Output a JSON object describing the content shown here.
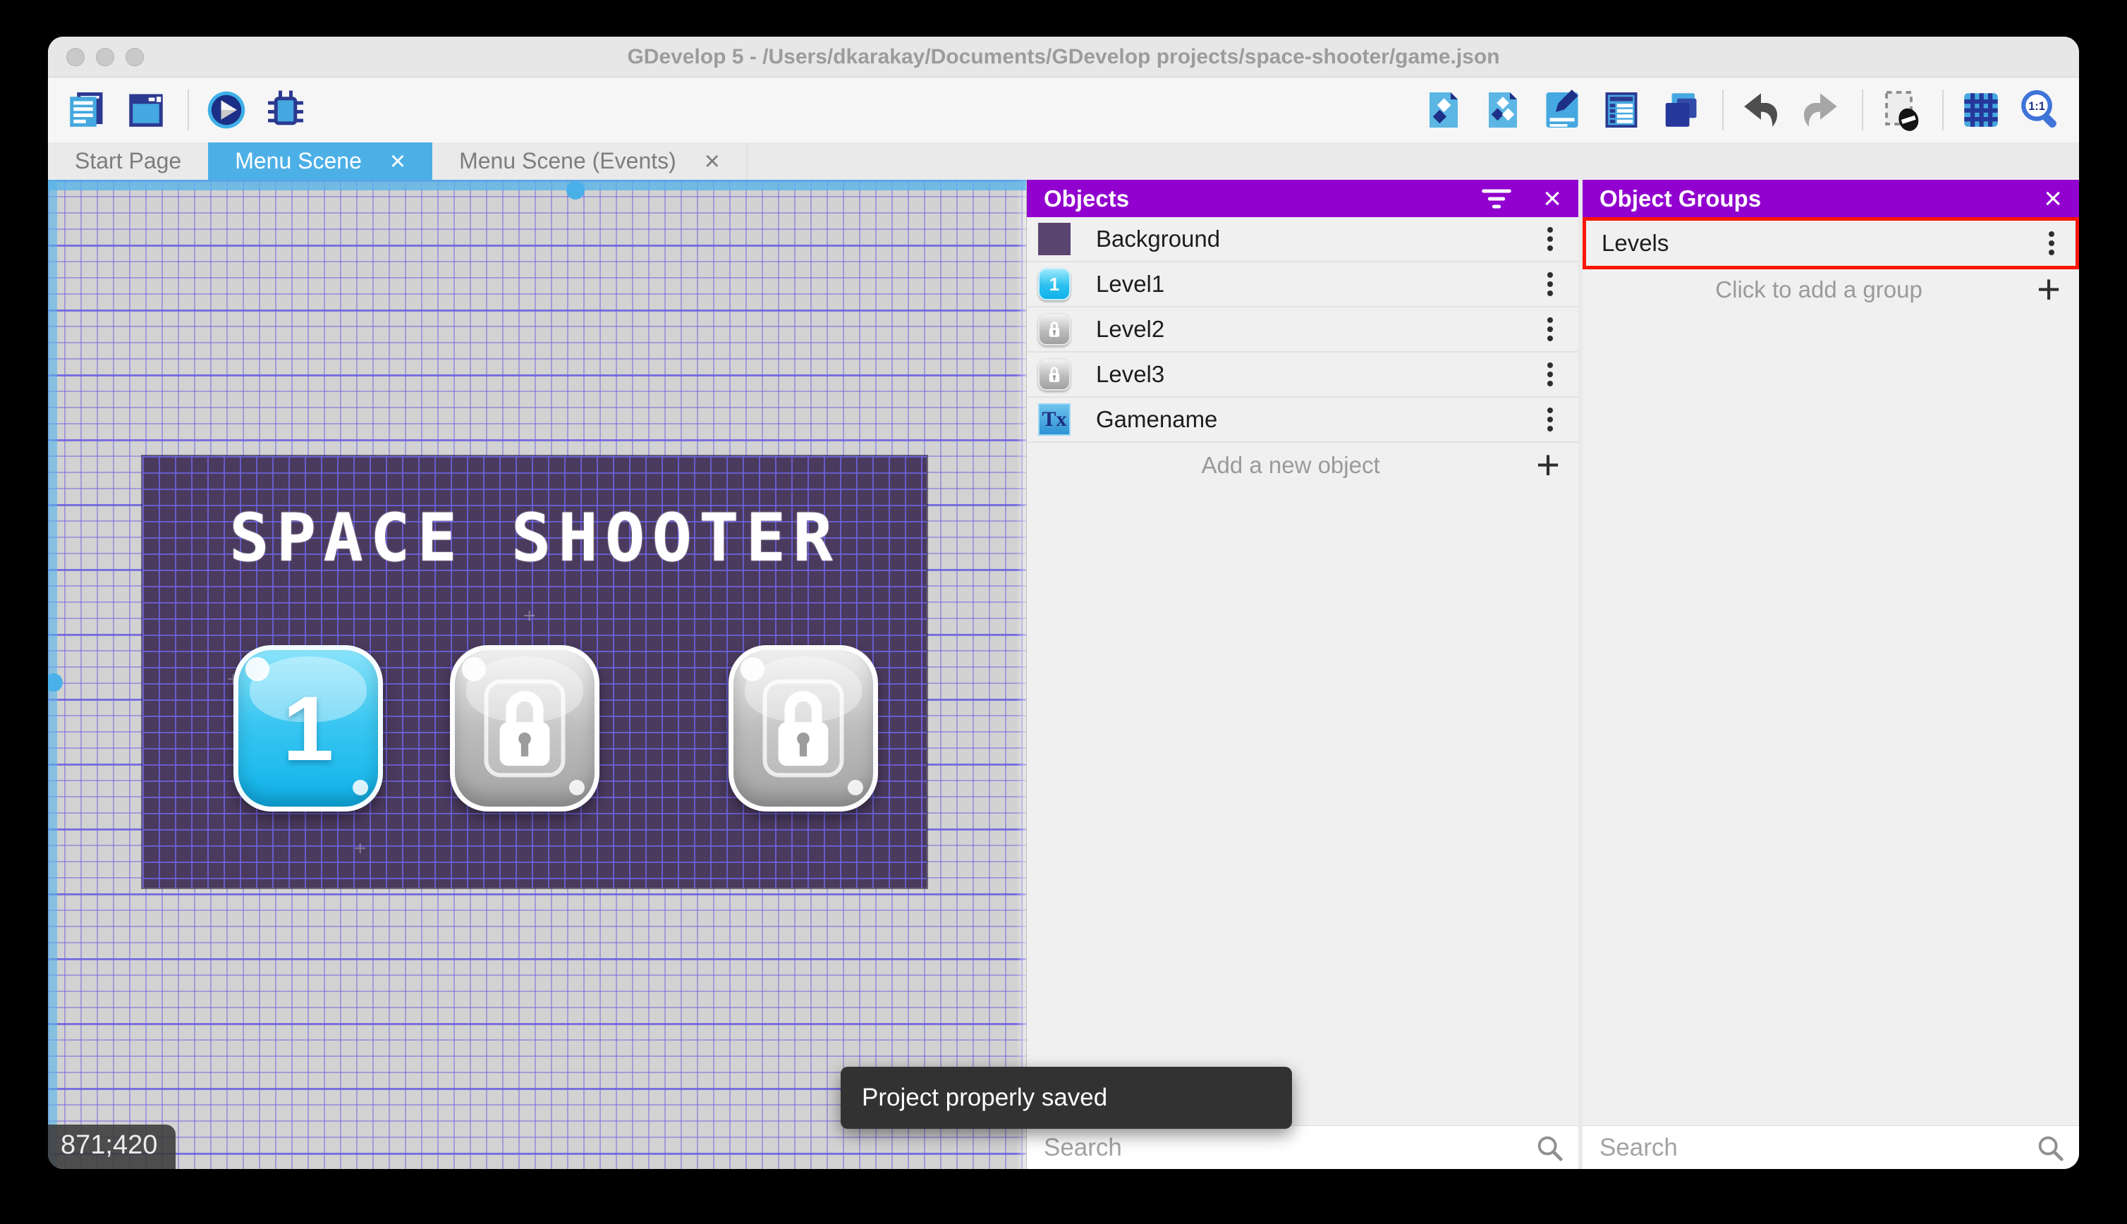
{
  "titlebar": {
    "title": "GDevelop 5 - /Users/dkarakay/Documents/GDevelop projects/space-shooter/game.json"
  },
  "toolbar": {
    "left_icons": [
      "project-manager",
      "scene-editors",
      "play",
      "debug"
    ],
    "right_icons": [
      "objects-editor",
      "object-groups-editor",
      "properties",
      "instances-list",
      "layers-editor",
      "undo",
      "redo",
      "window-mask",
      "grid",
      "zoom-1-1"
    ],
    "zoom_icon_label": "1:1"
  },
  "tabs": {
    "items": [
      {
        "label": "Start Page"
      },
      {
        "label": "Menu Scene"
      },
      {
        "label": "Menu Scene (Events)"
      }
    ],
    "active": "Menu Scene",
    "close_glyph": "×"
  },
  "scene": {
    "game_title": "SPACE SHOOTER",
    "coordinates": "871;420",
    "level_buttons": [
      {
        "label": "1",
        "state": "unlocked"
      },
      {
        "label": "",
        "state": "locked"
      },
      {
        "label": "",
        "state": "locked"
      }
    ]
  },
  "objects_panel": {
    "title": "Objects",
    "rows": [
      {
        "name": "Background",
        "thumb": "purple-square"
      },
      {
        "name": "Level1",
        "thumb": "blue-button-1"
      },
      {
        "name": "Level2",
        "thumb": "gray-lock-button"
      },
      {
        "name": "Level3",
        "thumb": "gray-lock-button"
      },
      {
        "name": "Gamename",
        "thumb": "text-object"
      }
    ],
    "thumb_text": "Tx",
    "level1_thumb_label": "1",
    "add_label": "Add a new object",
    "add_glyph": "+",
    "search_placeholder": "Search"
  },
  "groups_panel": {
    "title": "Object Groups",
    "rows": [
      {
        "name": "Levels"
      }
    ],
    "add_label": "Click to add a group",
    "add_glyph": "+",
    "search_placeholder": "Search"
  },
  "toast": {
    "message": "Project properly saved"
  },
  "colors": {
    "panel_header_purple": "#9100ce",
    "active_tab_blue": "#4cb0e6",
    "selection_blue": "#56b4e9",
    "annotation_red": "#fa1505",
    "toast_bg": "#323232",
    "game_background": "#4a3a5d",
    "grid_line": "#685ce1"
  }
}
